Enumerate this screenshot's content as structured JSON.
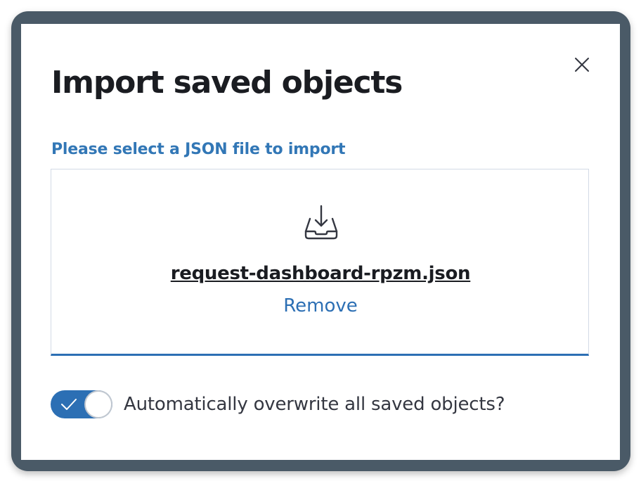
{
  "modal": {
    "title": "Import saved objects",
    "close_icon": "close-icon"
  },
  "file_picker": {
    "label": "Please select a JSON file to import",
    "icon": "upload-icon",
    "file_name": "request-dashboard-rpzm.json",
    "remove_label": "Remove"
  },
  "overwrite": {
    "label": "Automatically overwrite all saved objects?",
    "checked": true,
    "icon": "check-icon"
  },
  "colors": {
    "accent": "#2c6fb4",
    "label_blue": "#3277b6",
    "frame": "#4a5a67",
    "text_dark": "#1a1c21"
  }
}
